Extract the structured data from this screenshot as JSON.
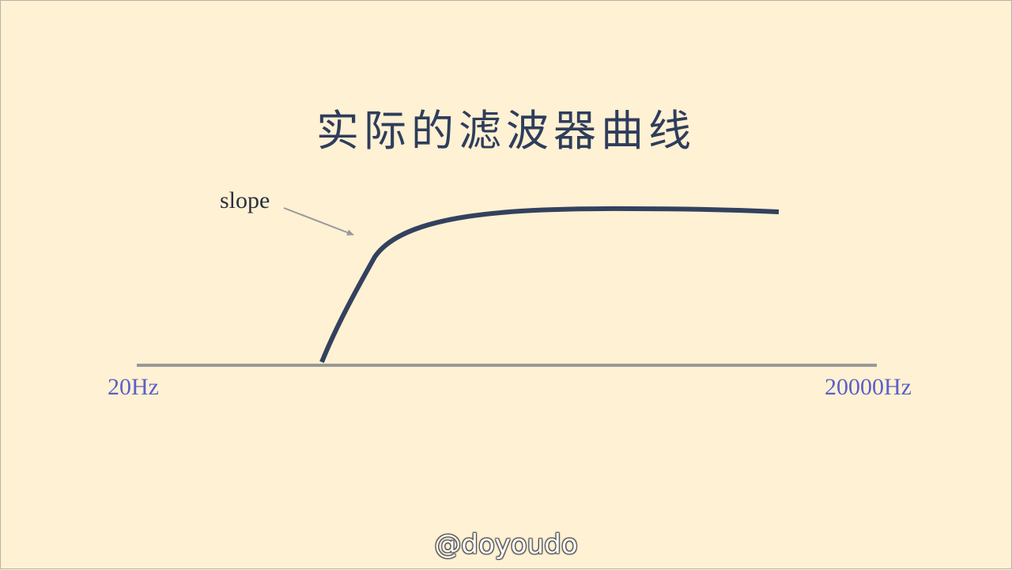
{
  "slide": {
    "title": "实际的滤波器曲线",
    "annotation": "slope",
    "axis": {
      "left_label": "20Hz",
      "right_label": "20000Hz"
    },
    "watermark": "@doyoudo",
    "colors": {
      "background": "#fff1d3",
      "curve": "#33415f",
      "axis_line": "#999999",
      "axis_labels": "#5c5fc9",
      "arrow": "#9a9a9a",
      "title": "#2f3d5c"
    }
  }
}
